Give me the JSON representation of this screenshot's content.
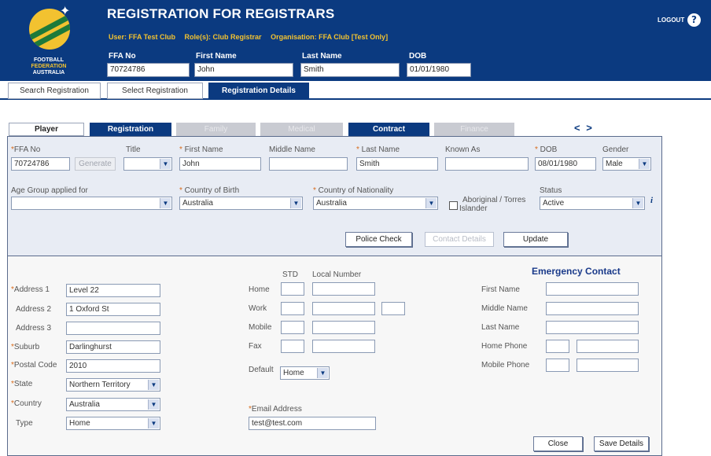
{
  "header": {
    "title": "REGISTRATION FOR REGISTRARS",
    "logo_lines": [
      "FOOTBALL",
      "FEDERATION",
      "AUSTRALIA"
    ],
    "user": "User: FFA Test Club",
    "roles": "Role(s): Club Registrar",
    "organisation": "Organisation: FFA Club [Test Only]",
    "ffa_no_label": "FFA No",
    "ffa_no_value": "70724786",
    "first_name_label": "First Name",
    "first_name_value": "John",
    "last_name_label": "Last Name",
    "last_name_value": "Smith",
    "dob_label": "DOB",
    "dob_value": "01/01/1980",
    "logout": "LOGOUT",
    "help": "?"
  },
  "nav_tabs": [
    {
      "label": "Search Registration"
    },
    {
      "label": "Select Registration"
    },
    {
      "label": "Registration Details"
    }
  ],
  "section_tabs": [
    {
      "label": "Player"
    },
    {
      "label": "Registration"
    },
    {
      "label": "Family"
    },
    {
      "label": "Medical"
    },
    {
      "label": "Contract"
    },
    {
      "label": "Finance"
    }
  ],
  "arrows": "< >",
  "player": {
    "ffa_no": {
      "label": "FFA No",
      "value": "70724786"
    },
    "generate_button": "Generate",
    "title": {
      "label": "Title",
      "value": ""
    },
    "first_name": {
      "label": "First Name",
      "value": "John"
    },
    "middle_name": {
      "label": "Middle Name",
      "value": ""
    },
    "last_name": {
      "label": "Last Name",
      "value": "Smith"
    },
    "known_as": {
      "label": "Known As",
      "value": ""
    },
    "dob": {
      "label": "DOB",
      "value": "08/01/1980"
    },
    "gender": {
      "label": "Gender",
      "value": "Male"
    },
    "age_group": {
      "label": "Age Group applied for",
      "value": ""
    },
    "country_birth": {
      "label": "Country of Birth",
      "value": "Australia"
    },
    "country_nationality": {
      "label": "Country of Nationality",
      "value": "Australia"
    },
    "aboriginal_line1": "Aboriginal / Torres",
    "aboriginal_line2": "Islander",
    "status": {
      "label": "Status",
      "value": "Active"
    },
    "info_icon": "i",
    "police_check_button": "Police Check",
    "contact_details_button": "Contact Details",
    "update_button": "Update"
  },
  "address": {
    "address1": {
      "label": "Address 1",
      "value": "Level 22"
    },
    "address2": {
      "label": "Address 2",
      "value": "1 Oxford St"
    },
    "address3": {
      "label": "Address 3",
      "value": ""
    },
    "suburb": {
      "label": "Suburb",
      "value": "Darlinghurst"
    },
    "postal_code": {
      "label": "Postal Code",
      "value": "2010"
    },
    "state": {
      "label": "State",
      "value": "Northern Territory"
    },
    "country": {
      "label": "Country",
      "value": "Australia"
    },
    "type": {
      "label": "Type",
      "value": "Home"
    }
  },
  "phones": {
    "std_header": "STD",
    "local_header": "Local Number",
    "home_label": "Home",
    "work_label": "Work",
    "mobile_label": "Mobile",
    "fax_label": "Fax",
    "default_label": "Default",
    "default_value": "Home",
    "email_label": "Email Address",
    "email_value": "test@test.com"
  },
  "emergency": {
    "title": "Emergency Contact",
    "first_name_label": "First Name",
    "middle_name_label": "Middle Name",
    "last_name_label": "Last Name",
    "home_phone_label": "Home Phone",
    "mobile_phone_label": "Mobile Phone"
  },
  "footer": {
    "close_button": "Close",
    "save_button": "Save Details"
  },
  "colors": {
    "brand_blue": "#0b3a80",
    "brand_gold": "#f2c230",
    "required_marker": "#d86a1a"
  }
}
